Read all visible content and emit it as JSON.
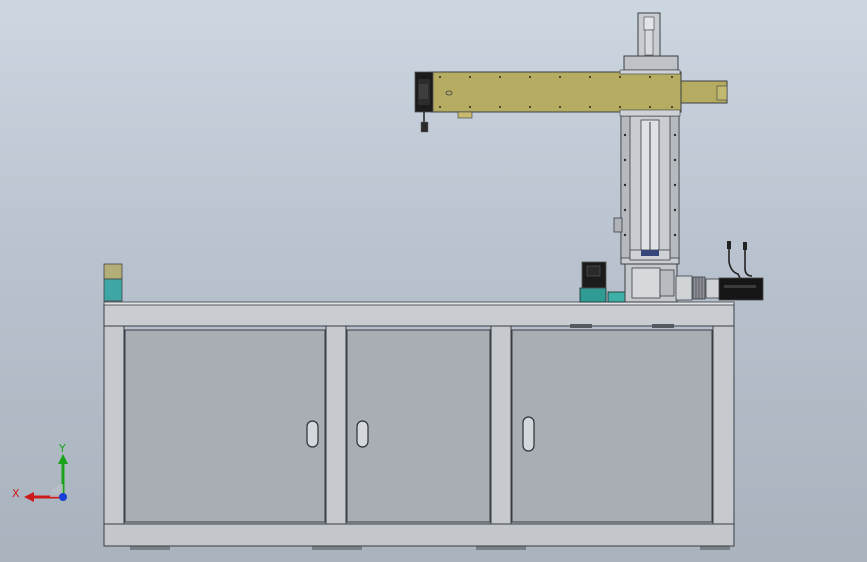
{
  "view": {
    "background_top": "#cdd7e2",
    "background_bottom": "#a9b3be"
  },
  "triad": {
    "x_label": "X",
    "y_label": "Y",
    "x_color": "#cc1a1a",
    "y_color": "#19a319",
    "z_color": "#1a3fd6"
  },
  "colors": {
    "arm_beam": "#b5ac62",
    "frame_steel": "#c9cdd1",
    "panel": "#a8adb3",
    "motor_black": "#1b1b1b",
    "teal_block": "#3aa6a0"
  }
}
